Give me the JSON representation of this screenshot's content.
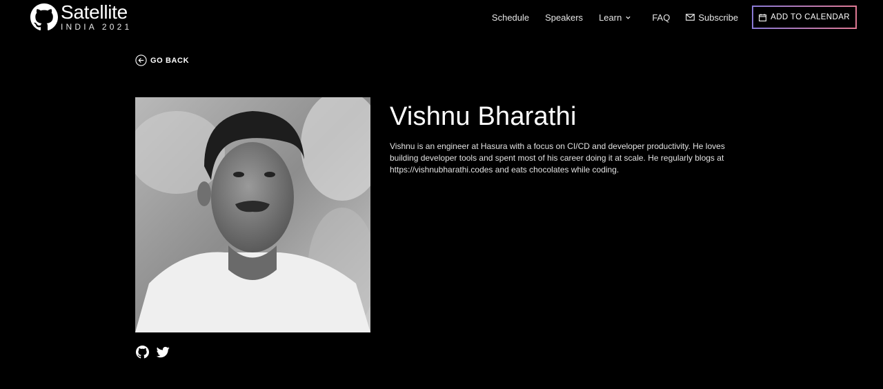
{
  "brand": {
    "title": "Satellite",
    "subtitle": "INDIA 2021",
    "icon": "github-octocat-icon"
  },
  "nav": {
    "schedule": "Schedule",
    "speakers": "Speakers",
    "learn": "Learn",
    "faq": "FAQ",
    "subscribe": "Subscribe",
    "add_to_calendar": "ADD TO CALENDAR"
  },
  "go_back": "GO BACK",
  "speaker": {
    "name": "Vishnu Bharathi",
    "bio": "Vishnu is an engineer at Hasura with a focus on CI/CD and developer productivity. He loves building developer tools and spent most of his career doing it at scale. He regularly blogs at https://vishnubharathi.codes and eats chocolates while coding.",
    "socials": [
      "github-icon",
      "twitter-icon"
    ]
  },
  "colors": {
    "background": "#000000",
    "text": "#ffffff",
    "calendar_border_start": "#8a7ad6",
    "calendar_border_end": "#e07a94"
  }
}
